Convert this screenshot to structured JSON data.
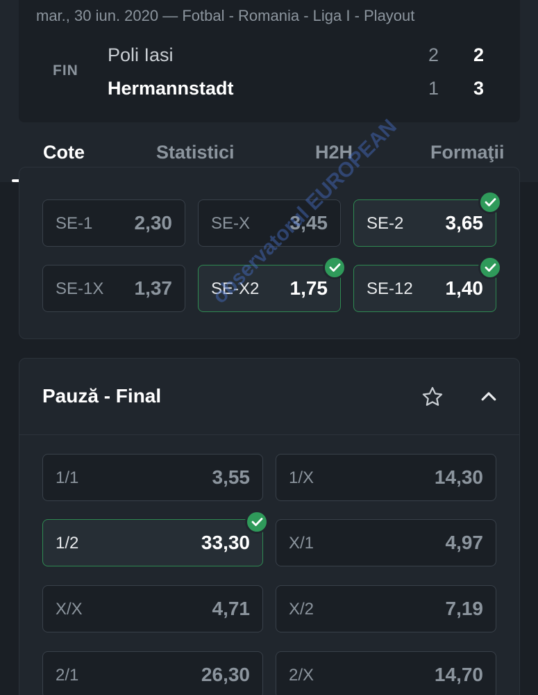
{
  "match": {
    "info": "mar., 30 iun. 2020 — Fotbal - Romania - Liga I - Playout",
    "status": "FIN",
    "home_team": "Poli Iasi",
    "away_team": "Hermannstadt",
    "home_ht": "2",
    "home_ft": "2",
    "away_ht": "1",
    "away_ft": "3"
  },
  "tabs": [
    "Cote",
    "Statistici",
    "H2H",
    "Formaţii"
  ],
  "chance_market": {
    "odds": [
      {
        "label": "SE-1",
        "value": "2,30",
        "selected": false
      },
      {
        "label": "SE-X",
        "value": "3,45",
        "selected": false
      },
      {
        "label": "SE-2",
        "value": "3,65",
        "selected": true
      },
      {
        "label": "SE-1X",
        "value": "1,37",
        "selected": false
      },
      {
        "label": "SE-X2",
        "value": "1,75",
        "selected": true
      },
      {
        "label": "SE-12",
        "value": "1,40",
        "selected": true
      }
    ]
  },
  "halftime_fulltime": {
    "title": "Pauză - Final",
    "odds": [
      {
        "label": "1/1",
        "value": "3,55",
        "selected": false
      },
      {
        "label": "1/X",
        "value": "14,30",
        "selected": false
      },
      {
        "label": "1/2",
        "value": "33,30",
        "selected": true
      },
      {
        "label": "X/1",
        "value": "4,97",
        "selected": false
      },
      {
        "label": "X/X",
        "value": "4,71",
        "selected": false
      },
      {
        "label": "X/2",
        "value": "7,19",
        "selected": false
      },
      {
        "label": "2/1",
        "value": "26,30",
        "selected": false
      },
      {
        "label": "2/X",
        "value": "14,70",
        "selected": false
      }
    ]
  },
  "icons": {
    "star": "star-outline-icon",
    "collapse": "chevron-up-icon",
    "check": "check-circle-icon"
  },
  "colors": {
    "background": "#1a1f25",
    "panel": "#20262d",
    "selected_border": "#2f8a52",
    "check": "#2f9a5a"
  },
  "watermark": "observatorul EUROPEAN"
}
